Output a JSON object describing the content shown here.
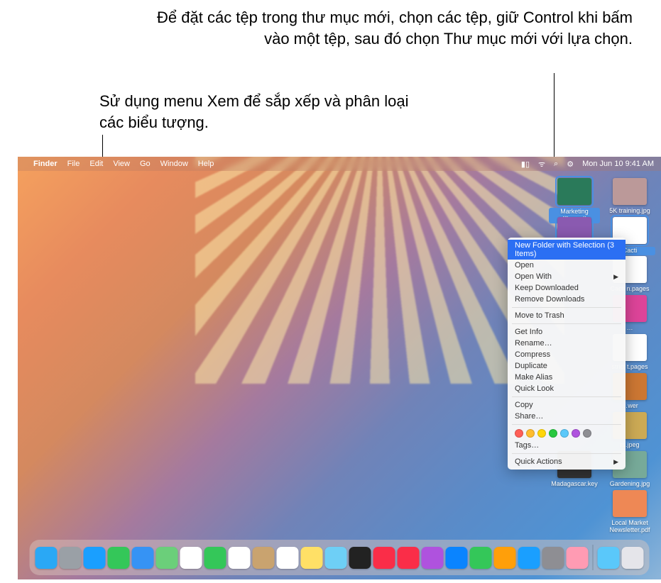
{
  "callouts": {
    "top": "Để đặt các tệp trong thư mục mới, chọn các tệp, giữ Control khi bấm vào một tệp, sau đó chọn Thư mục mới với lựa chọn.",
    "left": "Sử dụng menu Xem để sắp xếp và phân loại các biểu tượng."
  },
  "menubar": {
    "app": "Finder",
    "items": [
      "File",
      "Edit",
      "View",
      "Go",
      "Window",
      "Help"
    ],
    "datetime": "Mon Jun 10  9:41 AM"
  },
  "desktop_icons": [
    {
      "label": "Marketing Plan.pdf",
      "selected": true,
      "col": 0,
      "row": 0,
      "color": "#2a7a5a"
    },
    {
      "label": "5K training.jpg",
      "selected": false,
      "col": 1,
      "row": 0,
      "color": "#b99"
    },
    {
      "label": "",
      "selected": true,
      "col": 0,
      "row": 1,
      "color": "#8a5ab0"
    },
    {
      "label": "Cacti",
      "selected": true,
      "col": 1,
      "row": 1,
      "color": "#fff"
    },
    {
      "label": "Cacti n.pages",
      "selected": false,
      "col": 1,
      "row": 2,
      "color": "#fff"
    },
    {
      "label": "…",
      "selected": false,
      "col": 1,
      "row": 3,
      "color": "#d49"
    },
    {
      "label": "strict t.pages",
      "selected": false,
      "col": 1,
      "row": 4,
      "color": "#fff"
    },
    {
      "label": "…wer",
      "selected": false,
      "col": 1,
      "row": 5,
      "color": "#c73"
    },
    {
      "label": "rs.jpeg",
      "selected": false,
      "col": 1,
      "row": 6,
      "color": "#ca5"
    },
    {
      "label": "Madagascar.key",
      "selected": false,
      "col": 0,
      "row": 7,
      "color": "#333"
    },
    {
      "label": "Gardening.jpg",
      "selected": false,
      "col": 1,
      "row": 7,
      "color": "#7a9"
    },
    {
      "label": "Local Market Newsletter.pdf",
      "selected": false,
      "col": 1,
      "row": 8,
      "color": "#e85"
    }
  ],
  "context_menu": {
    "items": [
      {
        "label": "New Folder with Selection (3 Items)",
        "highlight": true
      },
      {
        "label": "Open"
      },
      {
        "label": "Open With",
        "submenu": true
      },
      {
        "label": "Keep Downloaded"
      },
      {
        "label": "Remove Downloads"
      },
      {
        "sep": true
      },
      {
        "label": "Move to Trash"
      },
      {
        "sep": true
      },
      {
        "label": "Get Info"
      },
      {
        "label": "Rename…"
      },
      {
        "label": "Compress"
      },
      {
        "label": "Duplicate"
      },
      {
        "label": "Make Alias"
      },
      {
        "label": "Quick Look"
      },
      {
        "sep": true
      },
      {
        "label": "Copy"
      },
      {
        "label": "Share…"
      },
      {
        "sep": true
      },
      {
        "tags": true,
        "colors": [
          "#ff5f57",
          "#ffbd2e",
          "#ffd60a",
          "#28c840",
          "#5ac8fa",
          "#af52de",
          "#8e8e93"
        ]
      },
      {
        "label": "Tags…"
      },
      {
        "sep": true
      },
      {
        "label": "Quick Actions",
        "submenu": true
      }
    ]
  },
  "dock": [
    {
      "name": "finder",
      "color": "#2aa8f5"
    },
    {
      "name": "launchpad",
      "color": "#9aa0a6"
    },
    {
      "name": "safari",
      "color": "#1a9fff"
    },
    {
      "name": "messages",
      "color": "#34c759"
    },
    {
      "name": "mail",
      "color": "#3693f4"
    },
    {
      "name": "maps",
      "color": "#6bcf7a"
    },
    {
      "name": "photos",
      "color": "#ffffff"
    },
    {
      "name": "facetime",
      "color": "#34c759"
    },
    {
      "name": "calendar",
      "color": "#ffffff"
    },
    {
      "name": "contacts",
      "color": "#c9a36f"
    },
    {
      "name": "reminders",
      "color": "#ffffff"
    },
    {
      "name": "notes",
      "color": "#ffe066"
    },
    {
      "name": "freeform",
      "color": "#6ecff6"
    },
    {
      "name": "tv",
      "color": "#222"
    },
    {
      "name": "music",
      "color": "#fa2d48"
    },
    {
      "name": "news",
      "color": "#fa2d48"
    },
    {
      "name": "podcasts",
      "color": "#af52de"
    },
    {
      "name": "keynote",
      "color": "#0a84ff"
    },
    {
      "name": "numbers",
      "color": "#34c759"
    },
    {
      "name": "pages",
      "color": "#ff9f0a"
    },
    {
      "name": "appstore",
      "color": "#1a9fff"
    },
    {
      "name": "settings",
      "color": "#8e8e93"
    },
    {
      "name": "iphone-mirror",
      "color": "#ff9bb3"
    },
    {
      "sep": true
    },
    {
      "name": "downloads",
      "color": "#5ac8fa"
    },
    {
      "name": "trash",
      "color": "#e5e5ea"
    }
  ]
}
